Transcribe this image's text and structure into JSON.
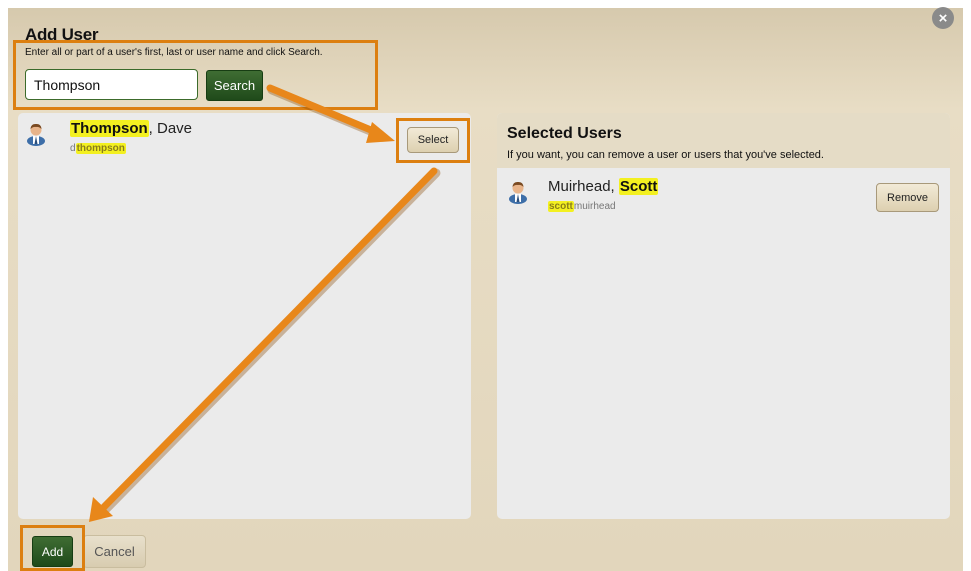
{
  "dialog": {
    "title": "Add User",
    "instructions": "Enter all or part of a user's first, last or user name and click Search.",
    "close_label": "×"
  },
  "search": {
    "value": "Thompson",
    "button_label": "Search"
  },
  "results": [
    {
      "name_highlight": "Thompson",
      "name_rest": ", Dave",
      "login_prefix": "d",
      "login_highlight": "thompson",
      "action_label": "Select"
    }
  ],
  "selected": {
    "title": "Selected Users",
    "subtitle": "If you want, you can remove a user or users that you've selected.",
    "users": [
      {
        "name_rest": "Muirhead, ",
        "name_highlight": "Scott",
        "login_highlight": "scott",
        "login_suffix": "muirhead",
        "action_label": "Remove"
      }
    ]
  },
  "footer": {
    "add_label": "Add",
    "cancel_label": "Cancel"
  },
  "colors": {
    "accent_green": "#2e5a24",
    "highlight": "#f3f020",
    "callout_orange": "#dc7f10",
    "dialog_tan": "#e2d6bc"
  },
  "icons": [
    "user-icon",
    "close-icon"
  ]
}
